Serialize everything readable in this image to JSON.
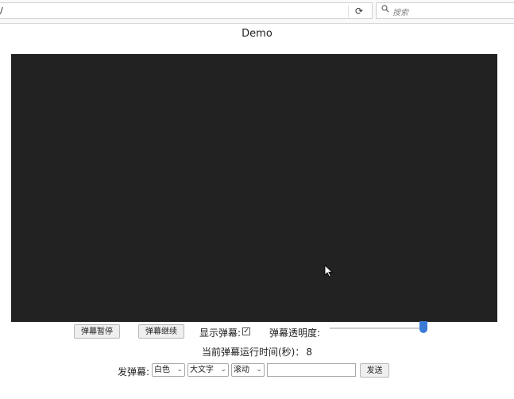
{
  "browser": {
    "url": "/",
    "reload_glyph": "⟳",
    "search_glyph": "🔍",
    "search_placeholder": "搜索"
  },
  "page": {
    "title": "Demo"
  },
  "controls": {
    "pause_label": "弹幕暂停",
    "resume_label": "弹幕继续",
    "show_label": "显示弹幕:",
    "show_checked": true,
    "check_glyph": "✓",
    "opacity_label": "弹幕透明度:",
    "opacity_value": 1.0
  },
  "runtime": {
    "label": "当前弹幕运行时间(秒)：",
    "value": "8"
  },
  "send": {
    "label": "发弹幕:",
    "color_selected": "白色",
    "size_selected": "大文字",
    "mode_selected": "滚动",
    "text_value": "",
    "send_label": "发送",
    "chev": "⌄"
  },
  "colors": {
    "video_bg": "#222222",
    "slider_thumb": "#3a7bd5"
  }
}
